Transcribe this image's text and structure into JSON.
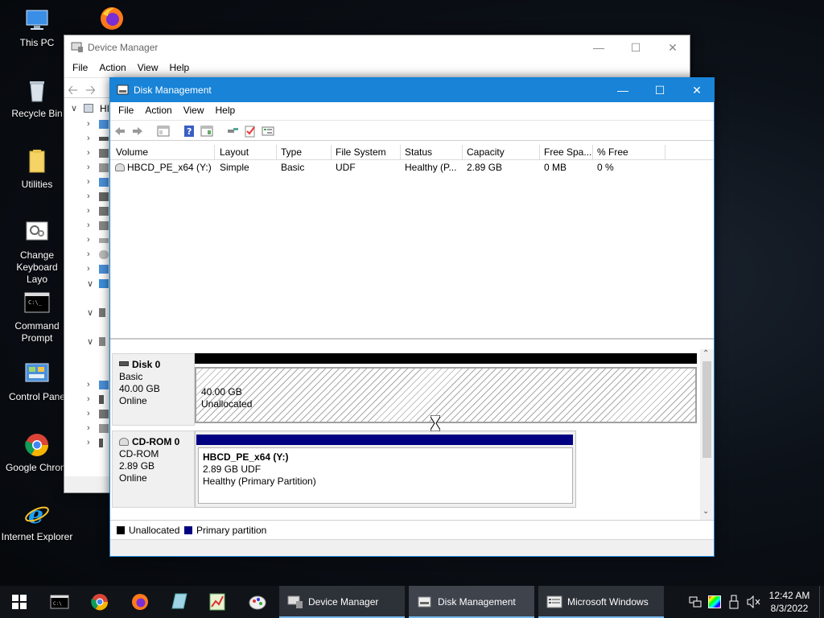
{
  "desktop": {
    "icons": [
      {
        "label": "This PC"
      },
      {
        "label": "Recycle Bin"
      },
      {
        "label": "Utilities"
      },
      {
        "label": "Change Keyboard Layo"
      },
      {
        "label": "Command Prompt"
      },
      {
        "label": "Control Pane"
      },
      {
        "label": "Google Chrom"
      },
      {
        "label": "Internet Explorer"
      }
    ]
  },
  "device_manager": {
    "title": "Device Manager",
    "menu": [
      "File",
      "Action",
      "View",
      "Help"
    ],
    "tree_root_label": "HI"
  },
  "disk_management": {
    "title": "Disk Management",
    "menu": [
      "File",
      "Action",
      "View",
      "Help"
    ],
    "volume_columns": [
      "Volume",
      "Layout",
      "Type",
      "File System",
      "Status",
      "Capacity",
      "Free Spa...",
      "% Free"
    ],
    "volumes": [
      {
        "volume": "HBCD_PE_x64 (Y:)",
        "layout": "Simple",
        "type": "Basic",
        "file_system": "UDF",
        "status": "Healthy (P...",
        "capacity": "2.89 GB",
        "free_space": "0 MB",
        "percent_free": "0 %"
      }
    ],
    "disks": [
      {
        "name": "Disk 0",
        "kind": "Basic",
        "size": "40.00 GB",
        "state": "Online",
        "partition": {
          "size": "40.00 GB",
          "label": "Unallocated"
        }
      },
      {
        "name": "CD-ROM 0",
        "kind": "CD-ROM",
        "size": "2.89 GB",
        "state": "Online",
        "partition": {
          "title": "HBCD_PE_x64  (Y:)",
          "size_fs": "2.89 GB UDF",
          "status": "Healthy (Primary Partition)"
        }
      }
    ],
    "legend": [
      {
        "label": "Unallocated",
        "color": "#000000"
      },
      {
        "label": "Primary partition",
        "color": "#000080"
      }
    ]
  },
  "taskbar": {
    "tasks": [
      {
        "label": "Device Manager"
      },
      {
        "label": "Disk Management"
      },
      {
        "label": "Microsoft Windows"
      }
    ],
    "clock": {
      "time": "12:42 AM",
      "date": "8/3/2022"
    }
  },
  "colors": {
    "accent": "#1883d7",
    "primary_partition": "#000080",
    "unallocated": "#000000"
  }
}
